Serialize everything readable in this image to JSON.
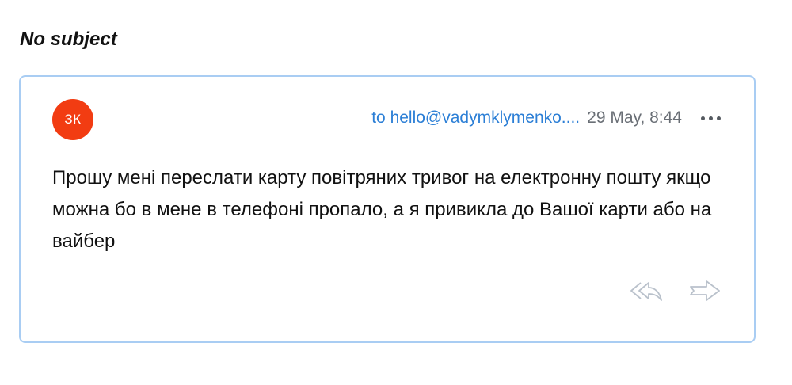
{
  "message": {
    "subject": "No subject",
    "avatar_initials": "ЗК",
    "avatar_color": "#f23c12",
    "recipient": "to hello@vadymklymenko....",
    "date": "29 May, 8:44",
    "body": "Прошу мені переслати карту повітряних тривог на електронну пошту якщо можна бо в мене в телефоні пропало, а я привикла до Вашої карти або на вайбер"
  },
  "icons": {
    "more": "more-horizontal-icon",
    "reply_all": "reply-all-icon",
    "forward": "forward-icon"
  },
  "colors": {
    "accent": "#2c7fd6",
    "card_border": "#a9cdf3"
  }
}
